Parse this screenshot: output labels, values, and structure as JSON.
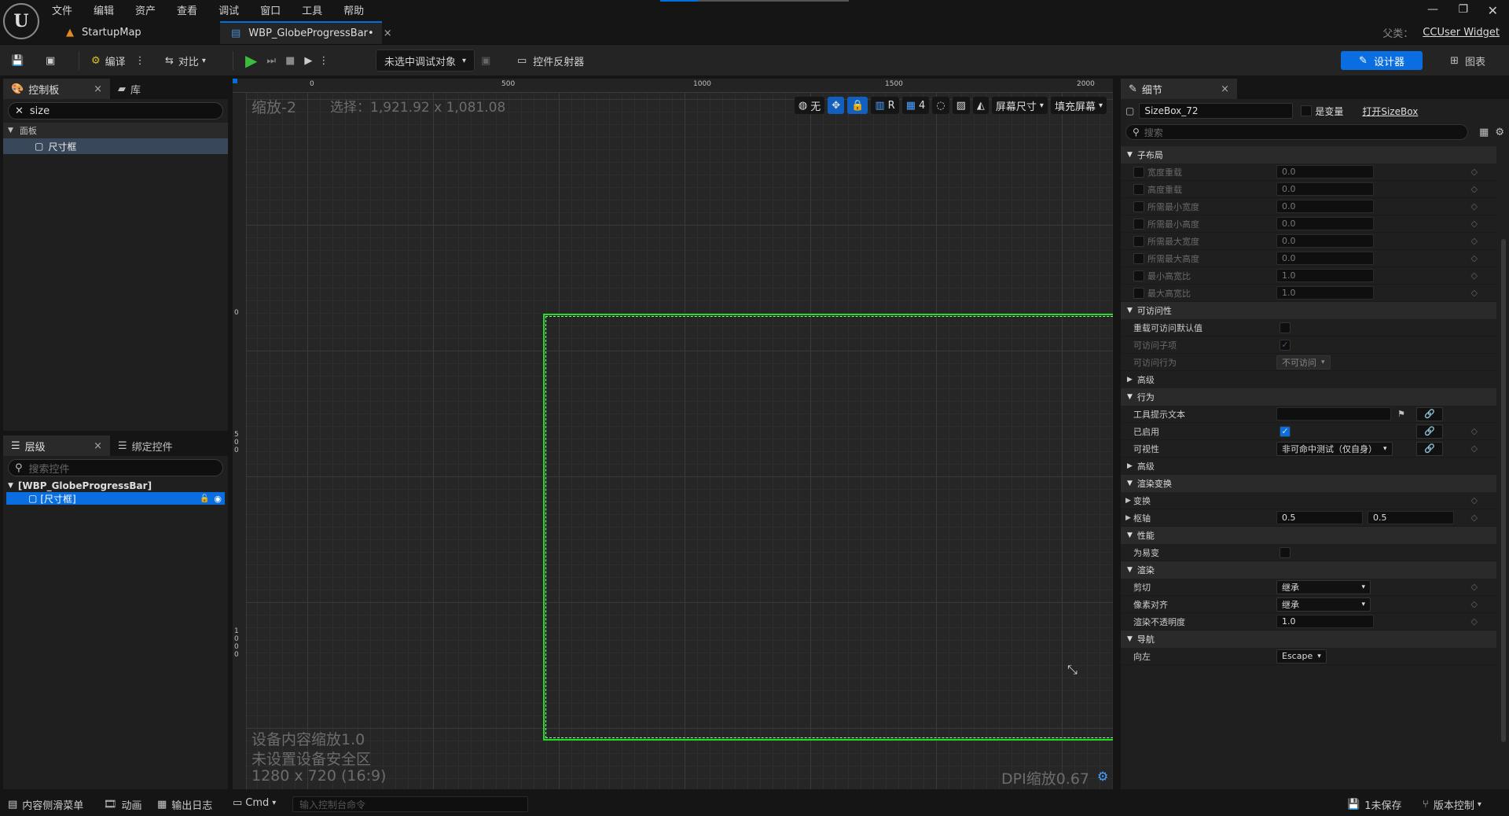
{
  "menu": [
    "文件",
    "编辑",
    "资产",
    "查看",
    "调试",
    "窗口",
    "工具",
    "帮助"
  ],
  "tabs": {
    "startup": "StartupMap",
    "widget": "WBP_GlobeProgressBar•"
  },
  "parent": {
    "label": "父类：",
    "value": "CCUser Widget"
  },
  "toolbar": {
    "compile": "编译",
    "diff": "对比",
    "debug_target": "未选中调试对象",
    "widget_reflector": "控件反射器",
    "designer": "设计器",
    "graph": "图表"
  },
  "palette": {
    "tab_palette": "控制板",
    "tab_library": "库",
    "search_value": "size",
    "category": "面板",
    "item": "尺寸框"
  },
  "hierarchy": {
    "tab_hierarchy": "层级",
    "tab_bind": "绑定控件",
    "search_placeholder": "搜索控件",
    "root": "[WBP_GlobeProgressBar]",
    "child": "[尺寸框]"
  },
  "canvas": {
    "zoom": "缩放-2",
    "selection": "选择：1,921.92 x 1,081.08",
    "ruler_labels": [
      "0",
      "500",
      "1000",
      "1500",
      "2000"
    ],
    "vruler_labels": [
      "0",
      "500",
      "1000"
    ],
    "tools": {
      "none": "无",
      "r": "R",
      "grid_num": "4",
      "screen_size": "屏幕尺寸",
      "fill": "填充屏幕"
    },
    "device_scale": "设备内容缩放1.0",
    "safe_zone": "未设置设备安全区",
    "resolution": "1280 x 720 (16:9)",
    "dpi": "DPI缩放0.67"
  },
  "details": {
    "tab": "细节",
    "name": "SizeBox_72",
    "is_variable": "是变量",
    "open_link": "打开SizeBox",
    "search_placeholder": "搜索",
    "sections": {
      "child_layout": "子布局",
      "accessibility": "可访问性",
      "advanced": "高级",
      "behavior": "行为",
      "render_transform": "渲染变换",
      "performance": "性能",
      "rendering": "渲染",
      "navigation": "导航"
    },
    "child_layout_rows": [
      {
        "label": "宽度重载",
        "value": "0.0"
      },
      {
        "label": "高度重载",
        "value": "0.0"
      },
      {
        "label": "所需最小宽度",
        "value": "0.0"
      },
      {
        "label": "所需最小高度",
        "value": "0.0"
      },
      {
        "label": "所需最大宽度",
        "value": "0.0"
      },
      {
        "label": "所需最大高度",
        "value": "0.0"
      },
      {
        "label": "最小高宽比",
        "value": "1.0"
      },
      {
        "label": "最大高宽比",
        "value": "1.0"
      }
    ],
    "accessibility_rows": {
      "override": "重载可访问默认值",
      "children": "可访问子项",
      "behavior": "可访问行为",
      "behavior_value": "不可访问"
    },
    "behavior_rows": {
      "tooltip": "工具提示文本",
      "enabled": "已启用",
      "visibility": "可视性",
      "visibility_value": "非可命中测试（仅自身）"
    },
    "transform_rows": {
      "transform": "变换",
      "pivot": "枢轴",
      "pivot_x": "0.5",
      "pivot_y": "0.5"
    },
    "performance_rows": {
      "volatile": "为易变"
    },
    "rendering_rows": {
      "clipping": "剪切",
      "clipping_value": "继承",
      "pixel_snap": "像素对齐",
      "pixel_snap_value": "继承",
      "opacity": "渲染不透明度",
      "opacity_value": "1.0"
    },
    "navigation_rows": {
      "left": "向左",
      "left_value": "Escape"
    }
  },
  "statusbar": {
    "drawer": "内容侧滑菜单",
    "anim": "动画",
    "log": "输出日志",
    "cmd": "Cmd",
    "cmd_placeholder": "输入控制台命令",
    "unsaved": "1未保存",
    "source_control": "版本控制"
  },
  "colors": {
    "accent": "#0070e0",
    "selection": "#22dd22"
  }
}
